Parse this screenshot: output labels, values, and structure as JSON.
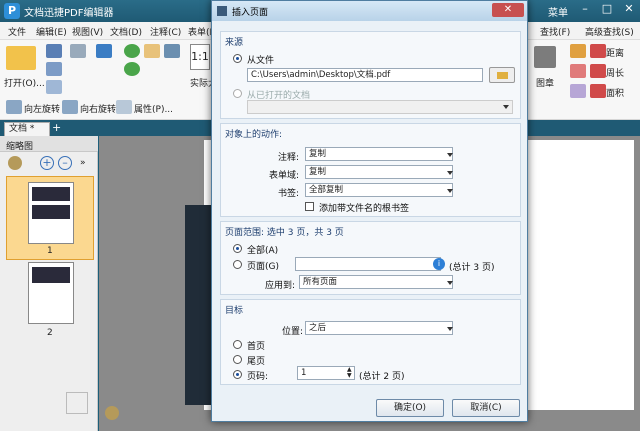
{
  "app": {
    "title": "文档迅捷PDF编辑器",
    "right_menu": "菜单"
  },
  "menubar": [
    "文件",
    "编辑(E)",
    "视图(V)",
    "文档(D)",
    "注释(C)",
    "表单(R)"
  ],
  "menubar_right": [
    "查找(F)",
    "高级查找(S)"
  ],
  "toolbar": {
    "open_label": "打开(O)...",
    "actual_size_label": "实际大",
    "rotate_left": "向左旋转",
    "rotate_right": "向右旋转",
    "properties": "属性(P)...",
    "stamp_label": "图章",
    "distance": "距离",
    "perimeter": "周长",
    "area": "面积"
  },
  "tab": {
    "label": "文档 *"
  },
  "sidebar": {
    "title": "缩略图",
    "thumbs": [
      "1",
      "2"
    ]
  },
  "dialog": {
    "title": "插入页面",
    "source": {
      "heading": "来源",
      "from_file": "从文件",
      "file_path": "C:\\Users\\admin\\Desktop\\文档.pdf",
      "from_open_doc": "从已打开的文档"
    },
    "actions": {
      "heading": "对象上的动作:",
      "comment_label": "注释:",
      "comment_value": "复制",
      "form_label": "表单域:",
      "form_value": "复制",
      "bookmark_label": "书签:",
      "bookmark_value": "全部复制",
      "add_bookmark": "添加带文件名的根书签"
    },
    "range": {
      "heading": "页面范围: 选中 3 页，共 3 页",
      "all": "全部(A)",
      "pages": "页面(G)",
      "total": "(总计 3 页)",
      "apply_label": "应用到:",
      "apply_value": "所有页面"
    },
    "target": {
      "heading": "目标",
      "position_label": "位置:",
      "position_value": "之后",
      "first": "首页",
      "last": "尾页",
      "page": "页码:",
      "page_value": "1",
      "total": "(总计 2 页)"
    },
    "ok": "确定(O)",
    "cancel": "取消(C)"
  }
}
